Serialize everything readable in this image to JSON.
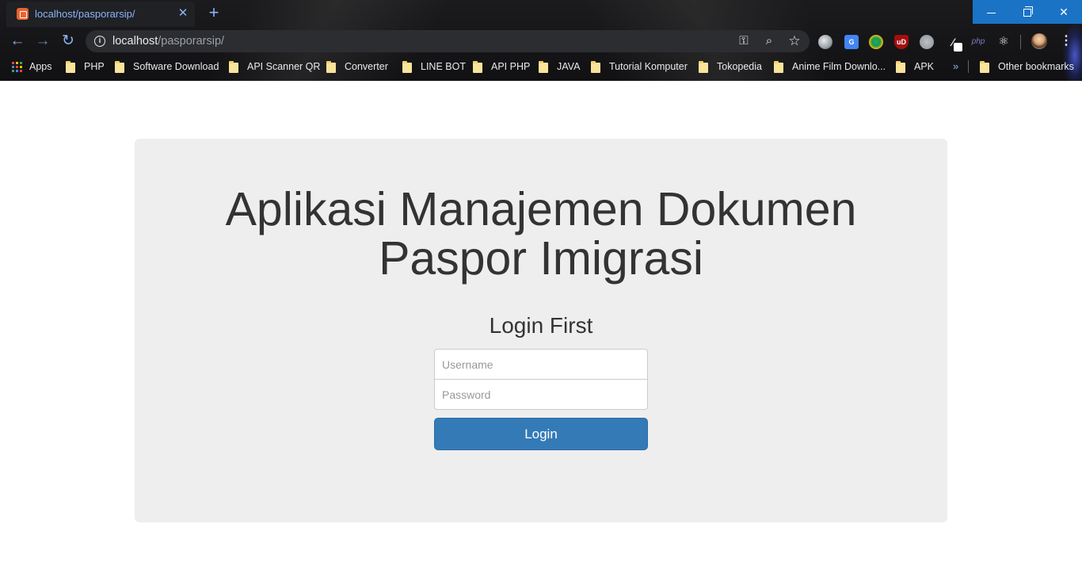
{
  "browser": {
    "tab": {
      "title": "localhost/pasporarsip/",
      "close_glyph": "✕",
      "favicon": "xampp-icon"
    },
    "new_tab_glyph": "+",
    "window_controls": {
      "minimize": "minimize-icon",
      "maximize": "restore-icon",
      "close_glyph": "✕"
    },
    "nav": {
      "back_glyph": "←",
      "forward_glyph": "→",
      "reload_glyph": "↻"
    },
    "omnibox": {
      "host": "localhost",
      "path": "/pasporarsip/",
      "info_glyph": "i",
      "key_glyph": "⚿",
      "zoom_glyph": "⌕",
      "star_glyph": "☆"
    },
    "extensions": [
      {
        "name": "globe-extension-icon",
        "glyph": ""
      },
      {
        "name": "translate-extension-icon",
        "glyph": "G"
      },
      {
        "name": "download-manager-extension-icon",
        "glyph": ""
      },
      {
        "name": "ublock-extension-icon",
        "glyph": "uD"
      },
      {
        "name": "vpn-globe-extension-icon",
        "glyph": ""
      },
      {
        "name": "eyedropper-extension-icon",
        "glyph": "⁄"
      },
      {
        "name": "php-extension-icon",
        "glyph": "php"
      },
      {
        "name": "react-devtools-extension-icon",
        "glyph": "⚛"
      }
    ],
    "menu_glyph": "⋮",
    "bookmarks": {
      "apps": "Apps",
      "items": [
        "PHP",
        "Software Download",
        "API Scanner QR",
        "Converter",
        "LINE BOT",
        "API PHP",
        "JAVA",
        "Tutorial Komputer",
        "Tokopedia",
        "Anime Film Downlo...",
        "APK"
      ],
      "overflow_glyph": "»",
      "other": "Other bookmarks",
      "apps_grid_colors": [
        "#ea4335",
        "#fbbc05",
        "#34a853",
        "#4285f4",
        "#ea4335",
        "#fbbc05",
        "#34a853",
        "#4285f4",
        "#ea4335"
      ]
    },
    "accent_color": "#1a73c5"
  },
  "page": {
    "title_line1": "Aplikasi Manajemen Dokumen",
    "title_line2": "Paspor Imigrasi",
    "login_heading": "Login First",
    "username_placeholder": "Username",
    "password_placeholder": "Password",
    "login_button": "Login",
    "primary_color": "#337ab7",
    "panel_color": "#eeeeee"
  }
}
